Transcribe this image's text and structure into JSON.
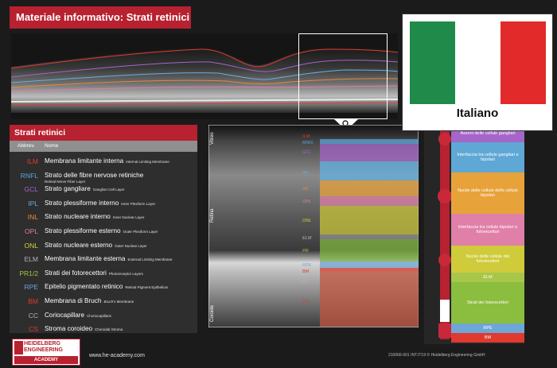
{
  "title": "Materiale informativo: Strati retinici",
  "legend": {
    "title": "Strati retinici",
    "col_abbrev": "Abbrev.",
    "col_name": "Nome",
    "rows": [
      {
        "abbr": "ILM",
        "name": "Membrana limitante interna",
        "en": "Internal Limiting Membrane",
        "color": "#e0392f"
      },
      {
        "abbr": "RNFL",
        "name": "Strato delle fibre nervose retiniche",
        "en": "Retinal Nerve Fiber Layer",
        "color": "#5aa6d8"
      },
      {
        "abbr": "GCL",
        "name": "Strato gangliare",
        "en": "Ganglion Cell Layer",
        "color": "#a565c8"
      },
      {
        "abbr": "IPL",
        "name": "Strato plessiforme interno",
        "en": "Inner Plexiform Layer",
        "color": "#63b1e2"
      },
      {
        "abbr": "INL",
        "name": "Strato nucleare interno",
        "en": "Inner Nuclear Layer",
        "color": "#e8883a"
      },
      {
        "abbr": "OPL",
        "name": "Strato plessiforme esterno",
        "en": "Outer Plexiform Layer",
        "color": "#de7fa7"
      },
      {
        "abbr": "ONL",
        "name": "Strato nucleare esterno",
        "en": "Outer Nuclear Layer",
        "color": "#d6d23a"
      },
      {
        "abbr": "ELM",
        "name": "Membrana limitante esterna",
        "en": "External Limiting Membrane",
        "color": "#b5b5b5"
      },
      {
        "abbr": "PR1/2",
        "name": "Strati dei fotorecettori",
        "en": "Photoreceptor Layers",
        "color": "#a2c83d"
      },
      {
        "abbr": "RPE",
        "name": "Epitelio pigmentato retinico",
        "en": "Retinal Pigment Epithelium",
        "color": "#6fa6d8"
      },
      {
        "abbr": "BM",
        "name": "Membrana di Bruch",
        "en": "Bruch's Membrane",
        "color": "#e0392f"
      },
      {
        "abbr": "CC",
        "name": "Coriocapillare",
        "en": "Choriocapillaris",
        "color": "#b0b0d0"
      },
      {
        "abbr": "CS",
        "name": "Stroma coroideo",
        "en": "Choroidal Stroma",
        "color": "#e0392f"
      }
    ]
  },
  "mid_labels": {
    "side": [
      "Vitreo",
      "Retina",
      "Coroide"
    ],
    "layers": [
      "ILM",
      "RNFL",
      "GCL",
      "IPL",
      "INL",
      "OPL",
      "ONL",
      "ELM",
      "PR",
      "RPE",
      "BM",
      "CC",
      "CS"
    ]
  },
  "right_labels": [
    {
      "text": "Assoni delle cellule gangliari",
      "bg": "#a566c9"
    },
    {
      "text": "Interfaccia tra cellule gangliari e bipolari",
      "bg": "#5fa8d6"
    },
    {
      "text": "Nuclei delle cellule delle cellule bipolari",
      "bg": "#e8a23a"
    },
    {
      "text": "Interfaccia tra cellule bipolari e fotorecettori",
      "bg": "#e080a8"
    },
    {
      "text": "Nuclei delle cellule dei fotorecettori",
      "bg": "#cfcb3a"
    },
    {
      "text": "ELM",
      "bg": "#a8c64a"
    },
    {
      "text": "Strati dei fotorecettori",
      "bg": "#8bbd3f"
    },
    {
      "text": "RPE",
      "bg": "#6fa6d8"
    },
    {
      "text": "BM",
      "bg": "#e0392f"
    }
  ],
  "flag_label": "Italiano",
  "logo": {
    "line1": "HEIDELBERG",
    "line2": "ENGINEERING",
    "academy": "ACADEMY"
  },
  "website": "www.he-academy.com",
  "copyright": "210066-001 INT.IT19 © Heidelberg Engineering GmbH"
}
